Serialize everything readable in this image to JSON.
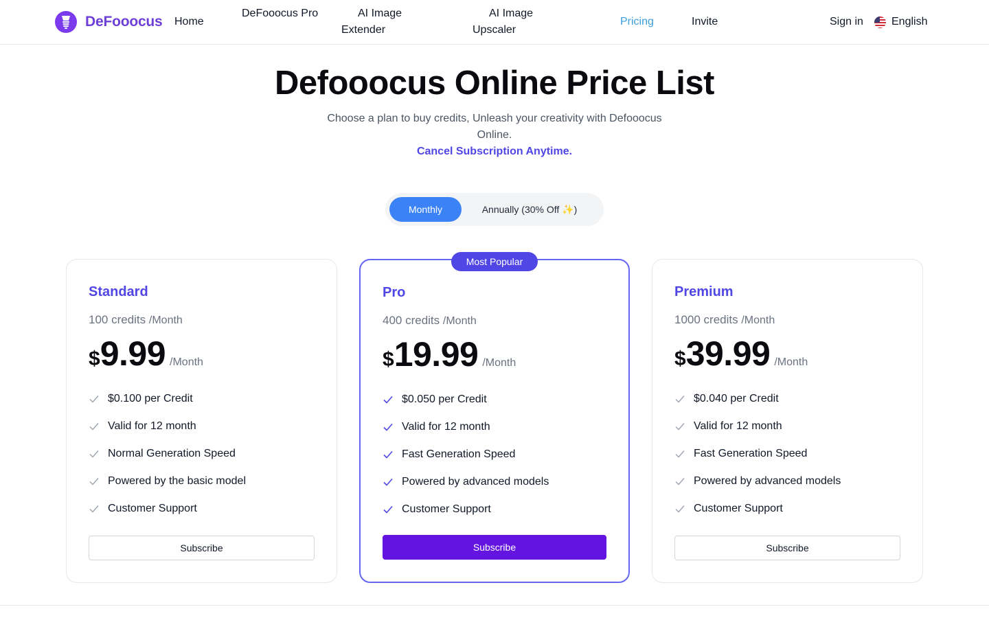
{
  "header": {
    "brand": "DeFooocus",
    "nav": [
      {
        "label": "Home"
      },
      {
        "label": "DeFooocus Pro"
      },
      {
        "label": "AI Image Extender"
      },
      {
        "label": "AI Image Upscaler"
      },
      {
        "label": "Pricing",
        "active": true
      },
      {
        "label": "Invite"
      }
    ],
    "signin": "Sign in",
    "language": "English"
  },
  "hero": {
    "title": "Defooocus Online Price List",
    "subtitle": "Choose a plan to buy credits, Unleash your creativity with Defooocus Online.",
    "cancel": "Cancel Subscription Anytime."
  },
  "billing_toggle": {
    "monthly": "Monthly",
    "annually": "Annually (30% Off ✨)",
    "selected": "monthly"
  },
  "plans": [
    {
      "name": "Standard",
      "credits": "100 credits",
      "credits_per": "/Month",
      "currency": "$",
      "price": "9.99",
      "price_per": "/Month",
      "features": [
        "$0.100 per Credit",
        "Valid for 12 month",
        "Normal Generation Speed",
        "Powered by the basic model",
        "Customer Support"
      ],
      "cta": "Subscribe"
    },
    {
      "name": "Pro",
      "badge": "Most Popular",
      "credits": "400 credits",
      "credits_per": "/Month",
      "currency": "$",
      "price": "19.99",
      "price_per": "/Month",
      "features": [
        "$0.050 per Credit",
        "Valid for 12 month",
        "Fast Generation Speed",
        "Powered by advanced models",
        "Customer Support"
      ],
      "cta": "Subscribe"
    },
    {
      "name": "Premium",
      "credits": "1000 credits",
      "credits_per": "/Month",
      "currency": "$",
      "price": "39.99",
      "price_per": "/Month",
      "features": [
        "$0.040 per Credit",
        "Valid for 12 month",
        "Fast Generation Speed",
        "Powered by advanced models",
        "Customer Support"
      ],
      "cta": "Subscribe"
    }
  ],
  "colors": {
    "brand": "#6d3fd8",
    "accent": "#4f46e5",
    "toggle_active": "#3b82f6",
    "pro_button": "#6414e0",
    "nav_active": "#3b9ede"
  }
}
